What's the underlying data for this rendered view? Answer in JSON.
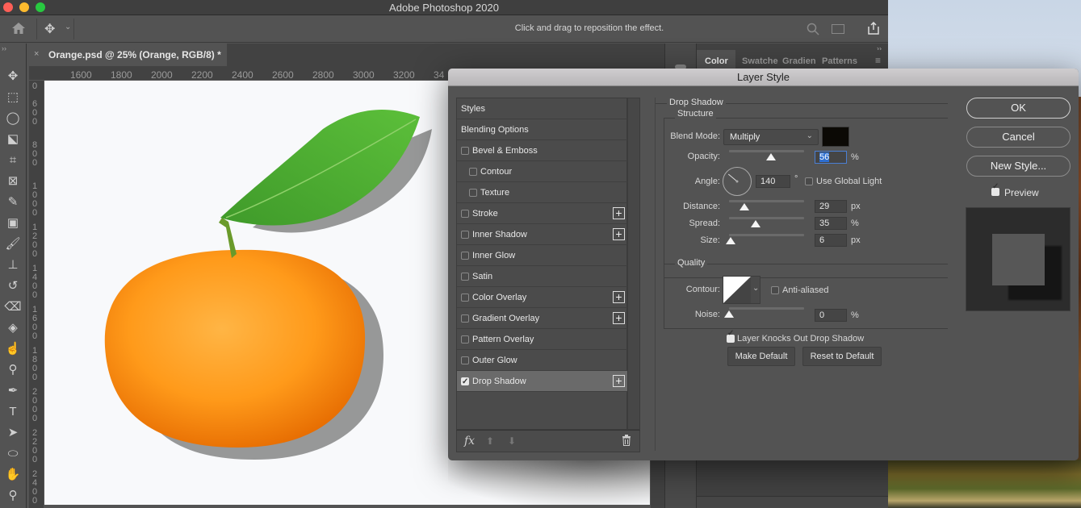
{
  "window": {
    "title": "Adobe Photoshop 2020",
    "traffic_colors": {
      "close": "#fe5f57",
      "minimize": "#febb2e",
      "zoom": "#28c940"
    }
  },
  "options_bar": {
    "hint": "Click and drag to reposition the effect.",
    "home_icon": "home-icon",
    "move_icon": "move-tool-icon",
    "search_icon": "search-icon",
    "workspace_icon": "workspace-icon",
    "share_icon": "share-icon"
  },
  "document_tab": {
    "close": "×",
    "label": "Orange.psd @ 25% (Orange, RGB/8) *"
  },
  "ruler_h": [
    "1600",
    "1800",
    "2000",
    "2200",
    "2400",
    "2600",
    "2800",
    "3000",
    "3200",
    "34"
  ],
  "ruler_v": [
    "0",
    "600",
    "800",
    "1000",
    "1200",
    "1400",
    "1600",
    "1800",
    "2000",
    "2200",
    "2400"
  ],
  "tools": [
    {
      "name": "move-tool-icon",
      "glyph": "✥"
    },
    {
      "name": "marquee-tool-icon",
      "glyph": "⬚"
    },
    {
      "name": "lasso-tool-icon",
      "glyph": "◯"
    },
    {
      "name": "object-select-tool-icon",
      "glyph": "⬕"
    },
    {
      "name": "crop-tool-icon",
      "glyph": "⌗"
    },
    {
      "name": "frame-tool-icon",
      "glyph": "⊠"
    },
    {
      "name": "eyedropper-tool-icon",
      "glyph": "✎"
    },
    {
      "name": "healing-brush-tool-icon",
      "glyph": "▣"
    },
    {
      "name": "brush-tool-icon",
      "glyph": "🖌"
    },
    {
      "name": "clone-stamp-tool-icon",
      "glyph": "⊥"
    },
    {
      "name": "history-brush-tool-icon",
      "glyph": "↺"
    },
    {
      "name": "eraser-tool-icon",
      "glyph": "⌫"
    },
    {
      "name": "paint-bucket-tool-icon",
      "glyph": "◈"
    },
    {
      "name": "smudge-tool-icon",
      "glyph": "☝"
    },
    {
      "name": "dodge-tool-icon",
      "glyph": "⚲"
    },
    {
      "name": "pen-tool-icon",
      "glyph": "✒"
    },
    {
      "name": "type-tool-icon",
      "glyph": "T"
    },
    {
      "name": "path-select-tool-icon",
      "glyph": "➤"
    },
    {
      "name": "ellipse-tool-icon",
      "glyph": "⬭"
    },
    {
      "name": "hand-tool-icon",
      "glyph": "✋"
    },
    {
      "name": "zoom-tool-icon",
      "glyph": "⚲"
    }
  ],
  "panels": {
    "tabs": [
      "Color",
      "Swatche",
      "Gradien",
      "Patterns"
    ],
    "active_tab": "Color"
  },
  "dialog": {
    "title": "Layer Style",
    "styles": [
      {
        "label": "Styles",
        "checkbox": false,
        "indent": false,
        "plus": false
      },
      {
        "label": "Blending Options",
        "checkbox": false,
        "indent": false,
        "plus": false
      },
      {
        "label": "Bevel & Emboss",
        "checkbox": true,
        "checked": false,
        "indent": false,
        "plus": false
      },
      {
        "label": "Contour",
        "checkbox": true,
        "checked": false,
        "indent": true,
        "plus": false
      },
      {
        "label": "Texture",
        "checkbox": true,
        "checked": false,
        "indent": true,
        "plus": false
      },
      {
        "label": "Stroke",
        "checkbox": true,
        "checked": false,
        "indent": false,
        "plus": true
      },
      {
        "label": "Inner Shadow",
        "checkbox": true,
        "checked": false,
        "indent": false,
        "plus": true
      },
      {
        "label": "Inner Glow",
        "checkbox": true,
        "checked": false,
        "indent": false,
        "plus": false
      },
      {
        "label": "Satin",
        "checkbox": true,
        "checked": false,
        "indent": false,
        "plus": false
      },
      {
        "label": "Color Overlay",
        "checkbox": true,
        "checked": false,
        "indent": false,
        "plus": true
      },
      {
        "label": "Gradient Overlay",
        "checkbox": true,
        "checked": false,
        "indent": false,
        "plus": true
      },
      {
        "label": "Pattern Overlay",
        "checkbox": true,
        "checked": false,
        "indent": false,
        "plus": false
      },
      {
        "label": "Outer Glow",
        "checkbox": true,
        "checked": false,
        "indent": false,
        "plus": false
      },
      {
        "label": "Drop Shadow",
        "checkbox": true,
        "checked": true,
        "indent": false,
        "plus": true,
        "selected": true
      }
    ],
    "footer": {
      "fx": "fx",
      "up_icon": "arrow-up-icon",
      "down_icon": "arrow-down-icon",
      "trash_icon": "trash-icon"
    },
    "section_title": "Drop Shadow",
    "structure": {
      "title": "Structure",
      "blend_mode_label": "Blend Mode:",
      "blend_mode_value": "Multiply",
      "shadow_color": "#0b0905",
      "opacity_label": "Opacity:",
      "opacity_value": "56",
      "opacity_unit": "%",
      "opacity_fraction": 0.56,
      "angle_label": "Angle:",
      "angle_value": "140",
      "angle_unit": "°",
      "angle_degrees": 140,
      "use_global_light_label": "Use Global Light",
      "use_global_light": false,
      "distance_label": "Distance:",
      "distance_value": "29",
      "distance_unit": "px",
      "distance_fraction": 0.2,
      "spread_label": "Spread:",
      "spread_value": "35",
      "spread_unit": "%",
      "spread_fraction": 0.35,
      "size_label": "Size:",
      "size_value": "6",
      "size_unit": "px",
      "size_fraction": 0.02
    },
    "quality": {
      "title": "Quality",
      "contour_label": "Contour:",
      "anti_aliased_label": "Anti-aliased",
      "anti_aliased": false,
      "noise_label": "Noise:",
      "noise_value": "0",
      "noise_unit": "%",
      "noise_fraction": 0
    },
    "knockout_label": "Layer Knocks Out Drop Shadow",
    "knockout": true,
    "make_default": "Make Default",
    "reset_default": "Reset to Default",
    "ok": "OK",
    "cancel": "Cancel",
    "new_style": "New Style...",
    "preview_label": "Preview",
    "preview": true
  }
}
